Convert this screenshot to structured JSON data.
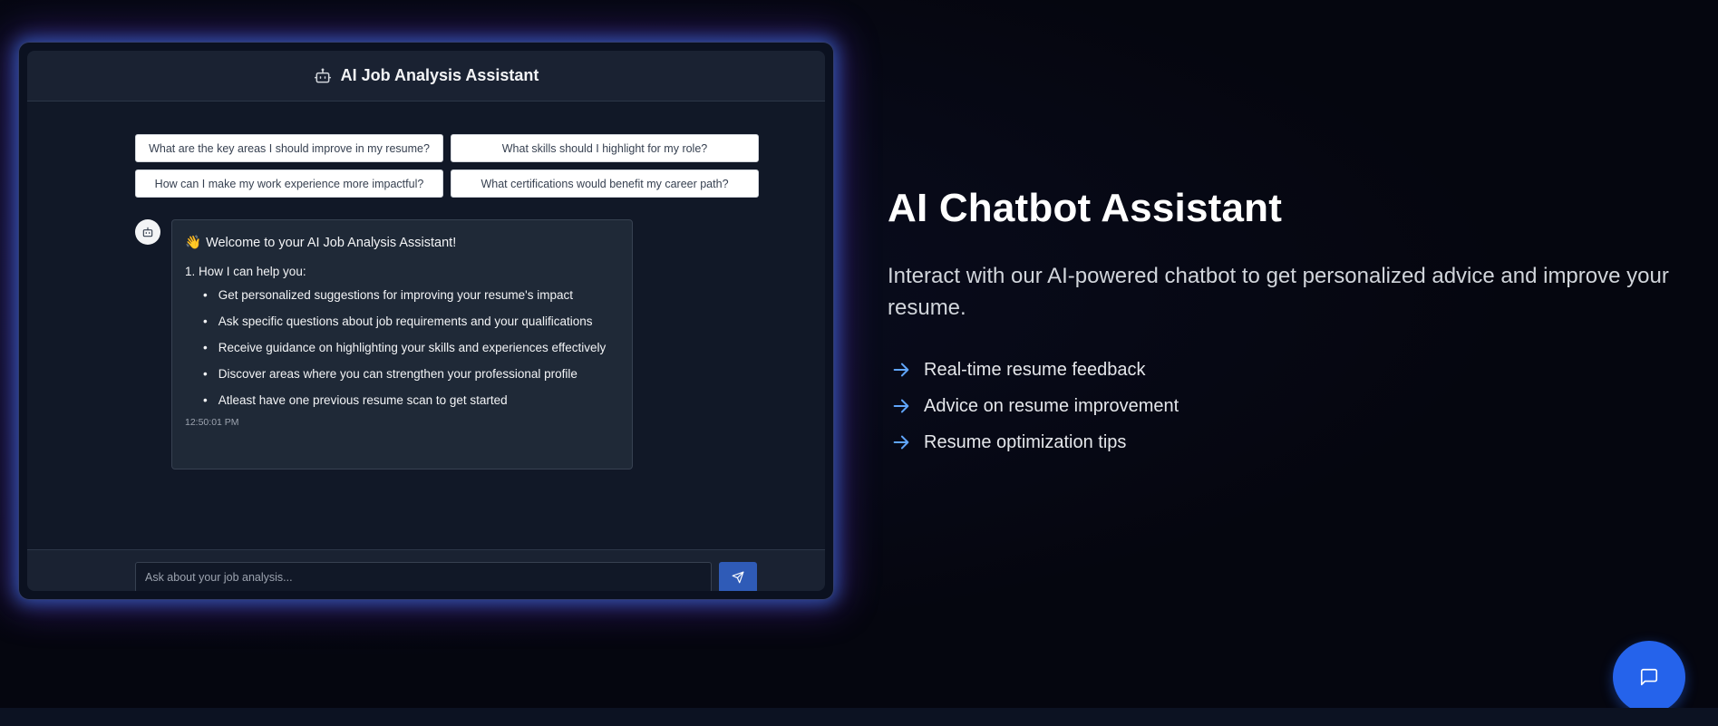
{
  "preview": {
    "header": {
      "title": "AI Job Analysis Assistant",
      "icon": "robot-icon"
    },
    "suggestions": [
      "What are the key areas I should improve in my resume?",
      "What skills should I highlight for my role?",
      "How can I make my work experience more impactful?",
      "What certifications would benefit my career path?"
    ],
    "message": {
      "avatar_icon": "robot-icon",
      "welcome_emoji": "👋",
      "welcome": "Welcome to your AI Job Analysis Assistant!",
      "heading": "1. How I can help you:",
      "items": [
        "Get personalized suggestions for improving your resume's impact",
        "Ask specific questions about job requirements and your qualifications",
        "Receive guidance on highlighting your skills and experiences effectively",
        "Discover areas where you can strengthen your professional profile",
        "Atleast have one previous resume scan to get started"
      ],
      "timestamp": "12:50:01 PM"
    },
    "input": {
      "placeholder": "Ask about your job analysis...",
      "send_icon": "send-icon"
    }
  },
  "feature": {
    "title": "AI Chatbot Assistant",
    "description": "Interact with our AI-powered chatbot to get personalized advice and improve your resume.",
    "items": [
      "Real-time resume feedback",
      "Advice on resume improvement",
      "Resume optimization tips"
    ],
    "item_icon": "arrow-right-icon"
  },
  "fab": {
    "icon": "chat-icon"
  },
  "colors": {
    "background": "#05060f",
    "accent": "#2563eb",
    "arrow": "#60a5fa",
    "glow_blue": "#3b82f6",
    "glow_purple": "#7c3aed"
  }
}
